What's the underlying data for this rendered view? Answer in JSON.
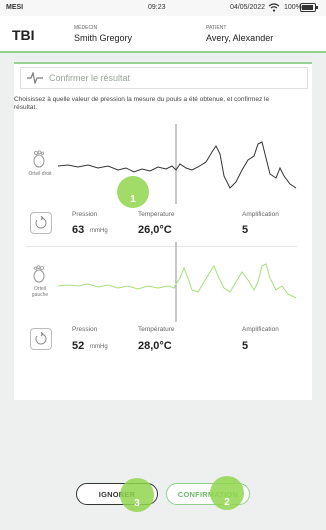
{
  "status": {
    "carrier": "MESI",
    "time": "09:23",
    "date": "04/05/2022",
    "battery": "100%"
  },
  "header": {
    "brand": "TBI",
    "doctor_label": "MÉDECIN",
    "doctor_name": "Smith Gregory",
    "patient_label": "PATIENT",
    "patient_name": "Avery, Alexander"
  },
  "card": {
    "title": "Confirmer le résultat",
    "instruction": "Choisissez à quelle valeur de pression la mesure du pouls a été obtenue, et confirmez le résultat."
  },
  "measurements": [
    {
      "site": "Orteil droit",
      "pressure_label": "Pression",
      "pressure_value": "63",
      "pressure_unit": "mmHg",
      "temperature_label": "Température",
      "temperature_value": "26,0°C",
      "amplification_label": "Amplification",
      "amplification_value": "5",
      "trace_color": "#333333",
      "marker": "1"
    },
    {
      "site": "Orteil gauche",
      "pressure_label": "Pression",
      "pressure_value": "52",
      "pressure_unit": "mmHg",
      "temperature_label": "Température",
      "temperature_value": "28,0°C",
      "amplification_label": "Amplification",
      "amplification_value": "5",
      "trace_color": "#a8df7a"
    }
  ],
  "buttons": {
    "ignore": "IGNORER",
    "confirm": "CONFIRMATION",
    "ignore_marker": "3",
    "confirm_marker": "2"
  },
  "colors": {
    "accent": "#8fcf8c",
    "marker": "#92d64e"
  },
  "icons": {
    "title": "pulse-wave-icon",
    "toe": "foot-icon",
    "rotate": "rotate-icon",
    "wifi": "wifi-icon",
    "battery": "battery-icon"
  }
}
